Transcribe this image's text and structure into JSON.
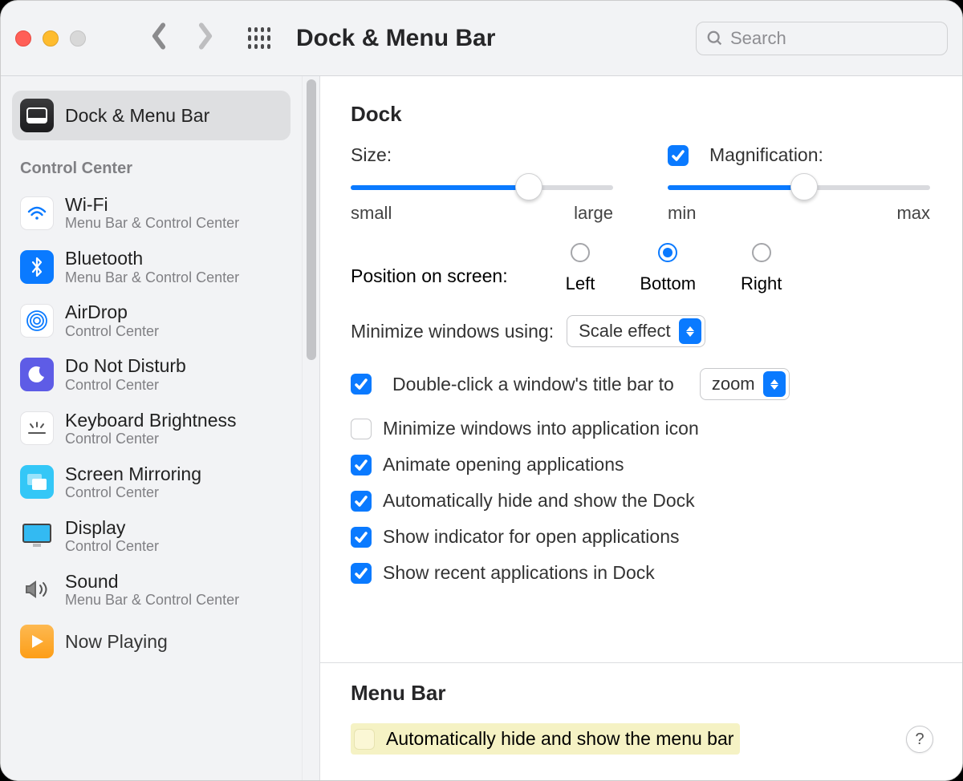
{
  "titlebar": {
    "title": "Dock & Menu Bar",
    "search_placeholder": "Search"
  },
  "sidebar": {
    "selected": {
      "title": "Dock & Menu Bar"
    },
    "section": "Control Center",
    "items": [
      {
        "title": "Wi-Fi",
        "sub": "Menu Bar & Control Center"
      },
      {
        "title": "Bluetooth",
        "sub": "Menu Bar & Control Center"
      },
      {
        "title": "AirDrop",
        "sub": "Control Center"
      },
      {
        "title": "Do Not Disturb",
        "sub": "Control Center"
      },
      {
        "title": "Keyboard Brightness",
        "sub": "Control Center"
      },
      {
        "title": "Screen Mirroring",
        "sub": "Control Center"
      },
      {
        "title": "Display",
        "sub": "Control Center"
      },
      {
        "title": "Sound",
        "sub": "Menu Bar & Control Center"
      },
      {
        "title": "Now Playing",
        "sub": ""
      }
    ]
  },
  "dock": {
    "heading": "Dock",
    "size": {
      "label": "Size:",
      "min": "small",
      "max": "large",
      "value": 68
    },
    "mag": {
      "label": "Magnification:",
      "checked": true,
      "min": "min",
      "max": "max",
      "value": 52
    },
    "position": {
      "label": "Position on screen:",
      "options": [
        "Left",
        "Bottom",
        "Right"
      ],
      "selected": "Bottom"
    },
    "minimize": {
      "label": "Minimize windows using:",
      "value": "Scale effect"
    },
    "dblclick": {
      "checked": true,
      "label": "Double-click a window's title bar to",
      "value": "zoom"
    },
    "opts": [
      {
        "checked": false,
        "label": "Minimize windows into application icon"
      },
      {
        "checked": true,
        "label": "Animate opening applications"
      },
      {
        "checked": true,
        "label": "Automatically hide and show the Dock"
      },
      {
        "checked": true,
        "label": "Show indicator for open applications"
      },
      {
        "checked": true,
        "label": "Show recent applications in Dock"
      }
    ]
  },
  "menubar": {
    "heading": "Menu Bar",
    "autohide": {
      "checked": false,
      "label": "Automatically hide and show the menu bar"
    }
  },
  "help": "?"
}
